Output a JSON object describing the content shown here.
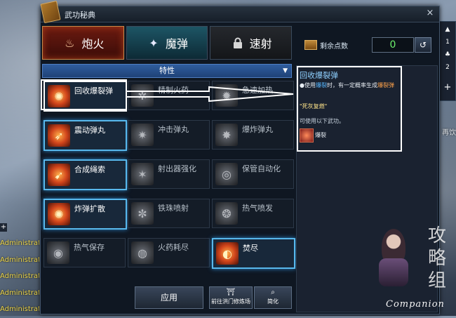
{
  "window": {
    "title": "武功秘典",
    "close_label": "×"
  },
  "tabs": [
    {
      "label": "炮火",
      "icon": "cannon-fire-icon",
      "active": true
    },
    {
      "label": "魔弹",
      "icon": "magic-bullet-icon",
      "active": false
    },
    {
      "label": "速射",
      "icon": "lock-icon",
      "active": false
    }
  ],
  "dropdown": {
    "selected": "特性"
  },
  "skills": [
    {
      "label": "回收爆裂弹",
      "state": "selected"
    },
    {
      "label": "精制火药",
      "state": "dim"
    },
    {
      "label": "急速加热",
      "state": "dim"
    },
    {
      "label": "震动弹丸",
      "state": "active"
    },
    {
      "label": "冲击弹丸",
      "state": "dim"
    },
    {
      "label": "爆炸弹丸",
      "state": "dim"
    },
    {
      "label": "合成绳索",
      "state": "active"
    },
    {
      "label": "射出器强化",
      "state": "dim"
    },
    {
      "label": "保管自动化",
      "state": "dim"
    },
    {
      "label": "炸弹扩散",
      "state": "active"
    },
    {
      "label": "铁珠喷射",
      "state": "dim"
    },
    {
      "label": "热气喷发",
      "state": "dim"
    },
    {
      "label": "热气保存",
      "state": "dim"
    },
    {
      "label": "火药耗尽",
      "state": "dim"
    },
    {
      "label": "焚尽",
      "state": "active"
    }
  ],
  "buttons": {
    "apply": "应用",
    "train": "前往洪门修炼场",
    "simplify": "简化"
  },
  "points": {
    "label": "剩余点数",
    "value": "0"
  },
  "info": {
    "title": "回收爆裂弹",
    "desc_prefix": "●使用",
    "desc_blue": "爆裂",
    "desc_mid": "时，有一定概率生成",
    "desc_orange": "爆裂弹",
    "quote": "\"死灰复燃\"",
    "usable": "可使用以下武功。",
    "skill": "爆裂"
  },
  "right_strip": {
    "item1": "1",
    "item2": "2",
    "add": "+"
  },
  "right_label": "再饮",
  "chat_lines": [
    "Administrat",
    "Administrat",
    "Administrat",
    "Administrat",
    "Administrat"
  ],
  "side_plus": "+",
  "watermark": {
    "glyphs": "攻略组",
    "text": "Companion"
  },
  "colors": {
    "accent_blue": "#58b8ec",
    "points_green": "#6cf06c",
    "orange": "#ffa24a"
  }
}
